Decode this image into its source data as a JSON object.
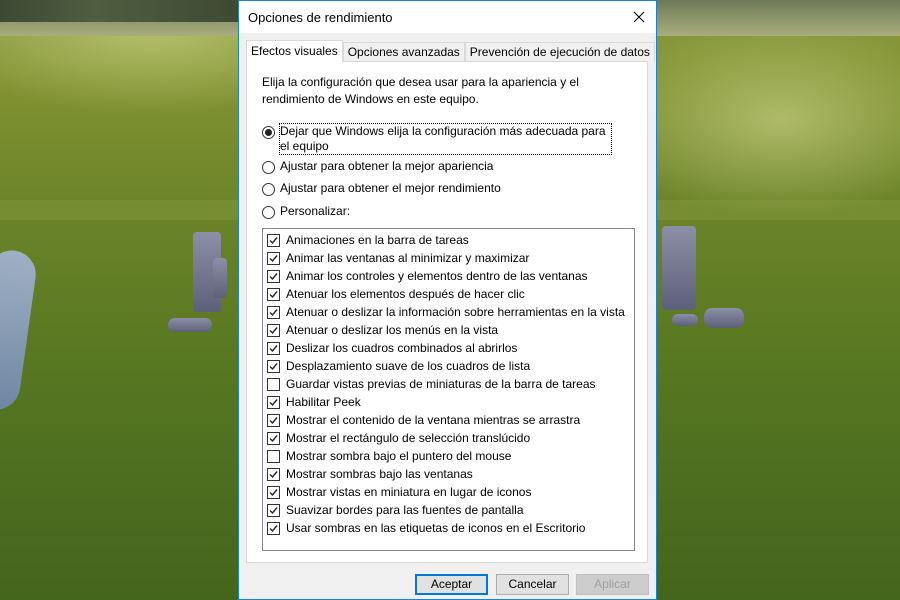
{
  "dialog": {
    "title": "Opciones de rendimiento",
    "tabs": [
      {
        "label": "Efectos visuales",
        "active": true
      },
      {
        "label": "Opciones avanzadas",
        "active": false
      },
      {
        "label": "Prevención de ejecución de datos",
        "active": false
      }
    ],
    "description": "Elija la configuración que desea usar para la apariencia y el rendimiento de Windows en este equipo.",
    "radio_options": [
      {
        "label": "Dejar que Windows elija la configuración más adecuada para el equipo",
        "checked": true
      },
      {
        "label": "Ajustar para obtener la mejor apariencia",
        "checked": false
      },
      {
        "label": "Ajustar para obtener el mejor rendimiento",
        "checked": false
      },
      {
        "label": "Personalizar:",
        "checked": false
      }
    ],
    "effects": [
      {
        "label": "Animaciones en la barra de tareas",
        "checked": true
      },
      {
        "label": "Animar las ventanas al minimizar y maximizar",
        "checked": true
      },
      {
        "label": "Animar los controles y elementos dentro de las ventanas",
        "checked": true
      },
      {
        "label": "Atenuar los elementos después de hacer clic",
        "checked": true
      },
      {
        "label": "Atenuar o deslizar la información sobre herramientas en la vista",
        "checked": true
      },
      {
        "label": "Atenuar o deslizar los menús en la vista",
        "checked": true
      },
      {
        "label": "Deslizar los cuadros combinados al abrirlos",
        "checked": true
      },
      {
        "label": "Desplazamiento suave de los cuadros de lista",
        "checked": true
      },
      {
        "label": "Guardar vistas previas de miniaturas de la barra de tareas",
        "checked": false
      },
      {
        "label": "Habilitar Peek",
        "checked": true
      },
      {
        "label": "Mostrar el contenido de la ventana mientras se arrastra",
        "checked": true
      },
      {
        "label": "Mostrar el rectángulo de selección translúcido",
        "checked": true
      },
      {
        "label": "Mostrar sombra bajo el puntero del mouse",
        "checked": false
      },
      {
        "label": "Mostrar sombras bajo las ventanas",
        "checked": true
      },
      {
        "label": "Mostrar vistas en miniatura en lugar de iconos",
        "checked": true
      },
      {
        "label": "Suavizar bordes para las fuentes de pantalla",
        "checked": true
      },
      {
        "label": "Usar sombras en las etiquetas de iconos en el Escritorio",
        "checked": true
      }
    ],
    "buttons": {
      "ok": "Aceptar",
      "cancel": "Cancelar",
      "apply": "Aplicar"
    },
    "colors": {
      "window_border": "#1883d7",
      "default_button_border": "#0078d7"
    }
  }
}
